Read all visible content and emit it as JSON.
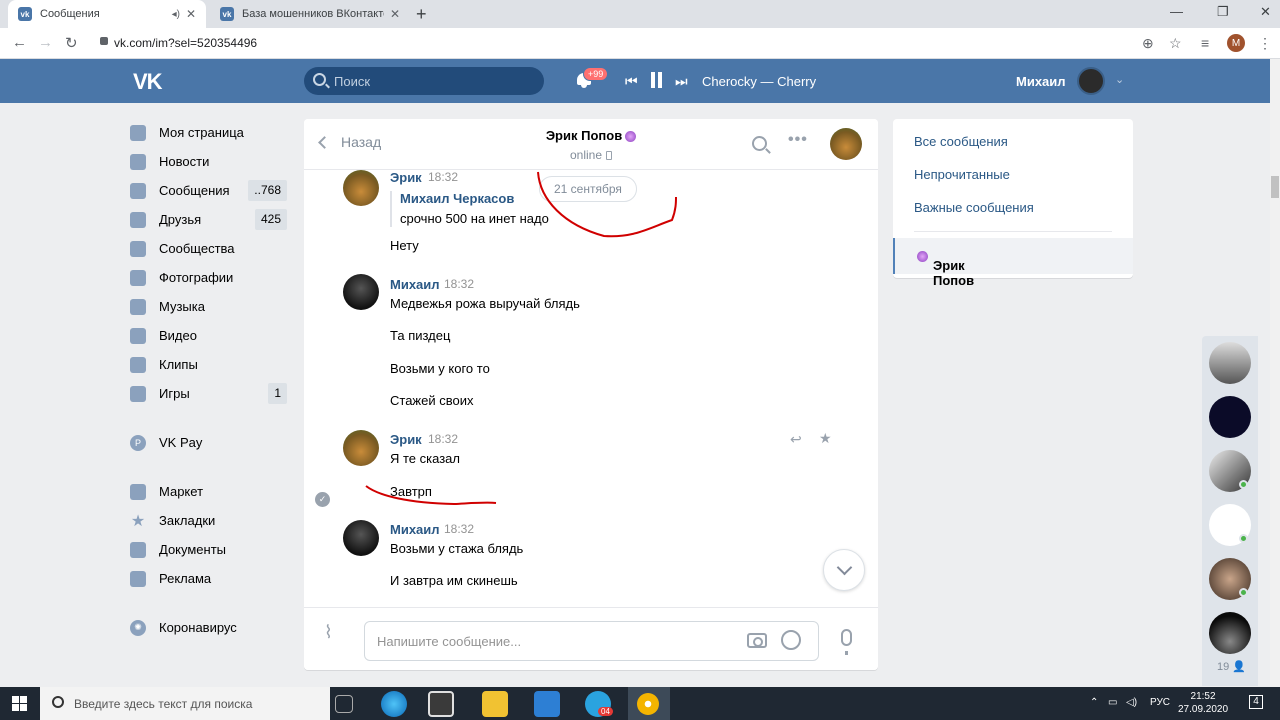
{
  "browser": {
    "tabs": [
      {
        "title": "Сообщения",
        "active": true
      },
      {
        "title": "База мошенников ВКонтакте Ки",
        "active": false
      }
    ],
    "url": "vk.com/im?sel=520354496",
    "profile_letter": "M"
  },
  "header": {
    "search_placeholder": "Поиск",
    "notif_badge": "+99",
    "track": "Cherocky — Cherry",
    "user_name": "Михаил"
  },
  "menu": {
    "items": [
      {
        "label": "Моя страница",
        "icon": "user-icon",
        "count": ""
      },
      {
        "label": "Новости",
        "icon": "news-icon",
        "count": ""
      },
      {
        "label": "Сообщения",
        "icon": "chat-icon",
        "count": "..768"
      },
      {
        "label": "Друзья",
        "icon": "friends-icon",
        "count": "425"
      },
      {
        "label": "Сообщества",
        "icon": "groups-icon",
        "count": ""
      },
      {
        "label": "Фотографии",
        "icon": "camera-icon",
        "count": ""
      },
      {
        "label": "Музыка",
        "icon": "music-icon",
        "count": ""
      },
      {
        "label": "Видео",
        "icon": "video-icon",
        "count": ""
      },
      {
        "label": "Клипы",
        "icon": "clips-icon",
        "count": ""
      },
      {
        "label": "Игры",
        "icon": "gamepad-icon",
        "count": "1"
      },
      {
        "label": "VK Pay",
        "icon": "pay-icon",
        "count": ""
      },
      {
        "label": "Маркет",
        "icon": "bag-icon",
        "count": ""
      },
      {
        "label": "Закладки",
        "icon": "star-icon",
        "count": ""
      },
      {
        "label": "Документы",
        "icon": "document-icon",
        "count": ""
      },
      {
        "label": "Реклама",
        "icon": "megaphone-icon",
        "count": ""
      },
      {
        "label": "Коронавирус",
        "icon": "virus-icon",
        "count": ""
      }
    ]
  },
  "chat": {
    "back_label": "Назад",
    "peer_name": "Эрик Попов",
    "peer_status": "online",
    "date_pill": "21 сентября",
    "messages": [
      {
        "author": "Эрик",
        "time": "18:32",
        "quote_author": "Михаил Черкасов",
        "quote_text": "срочно 500 на инет надо",
        "lines": [
          "Нету"
        ]
      },
      {
        "author": "Михаил",
        "time": "18:32",
        "lines": [
          "Медвежья рожа выручай блядь",
          "Та пиздец",
          "Возьми у кого то",
          "Стажей своих"
        ]
      },
      {
        "author": "Эрик",
        "time": "18:32",
        "lines": [
          "Я те сказал",
          "Завтрп"
        ]
      },
      {
        "author": "Михаил",
        "time": "18:32",
        "lines": [
          "Возьми у стажа блядь",
          "И завтра им скинешь"
        ]
      }
    ],
    "composer_placeholder": "Напишите сообщение..."
  },
  "right": {
    "links": [
      "Все сообщения",
      "Непрочитанные",
      "Важные сообщения"
    ],
    "active_dialog": "Эрик Попов"
  },
  "contacts": {
    "count": "19"
  },
  "taskbar": {
    "search_placeholder": "Введите здесь текст для поиска",
    "lang": "РУС",
    "time": "21:52",
    "date": "27.09.2020",
    "notif_count": "4",
    "telegram_badge": "04"
  },
  "colors": {
    "vk_blue": "#4a76a8",
    "link": "#2a5885",
    "annotation_red": "#d00000"
  }
}
